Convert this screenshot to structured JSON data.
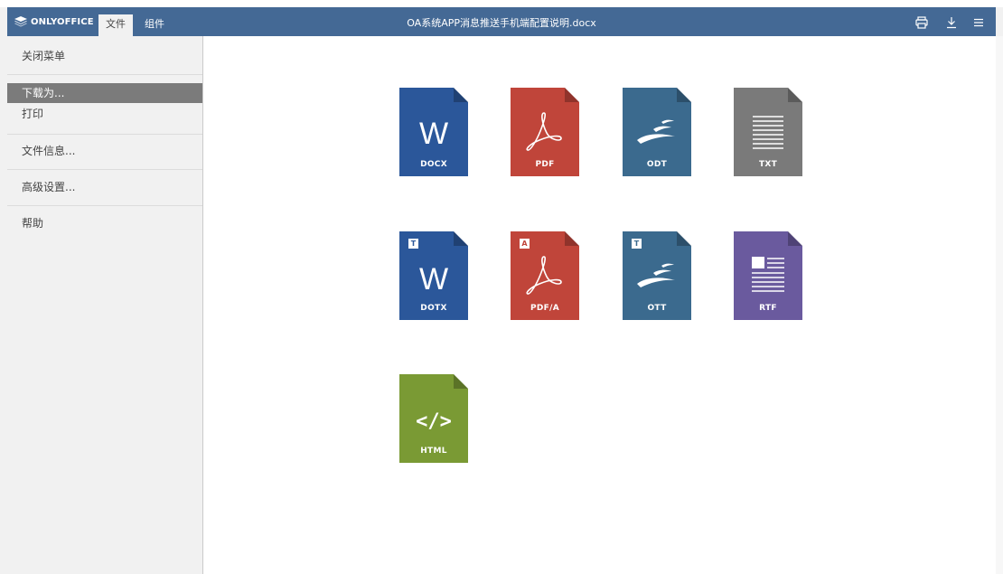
{
  "app": {
    "logo_text": "ONLYOFFICE"
  },
  "tabs": [
    {
      "label": "文件"
    },
    {
      "label": "组件"
    }
  ],
  "document": {
    "title": "OA系统APP消息推送手机端配置说明.docx"
  },
  "toolbar": {
    "icons": [
      "print-icon",
      "download-icon",
      "menu-icon"
    ]
  },
  "menu": {
    "items": [
      {
        "label": "关闭菜单"
      },
      {
        "label": "下载为..."
      },
      {
        "label": "打印"
      },
      {
        "label": "文件信息..."
      },
      {
        "label": "高级设置..."
      },
      {
        "label": "帮助"
      }
    ],
    "selected": "下载为..."
  },
  "formats": [
    {
      "label": "DOCX",
      "color": "#2b579a"
    },
    {
      "label": "PDF",
      "color": "#c0453a"
    },
    {
      "label": "ODT",
      "color": "#3b6a8e"
    },
    {
      "label": "TXT",
      "color": "#7a7a7a"
    },
    {
      "label": "DOTX",
      "color": "#2b579a",
      "badge": "T"
    },
    {
      "label": "PDF/A",
      "color": "#c0453a",
      "badge": "A"
    },
    {
      "label": "OTT",
      "color": "#3b6a8e",
      "badge": "T"
    },
    {
      "label": "RTF",
      "color": "#6a5a9e"
    },
    {
      "label": "HTML",
      "color": "#7a9a34"
    }
  ]
}
